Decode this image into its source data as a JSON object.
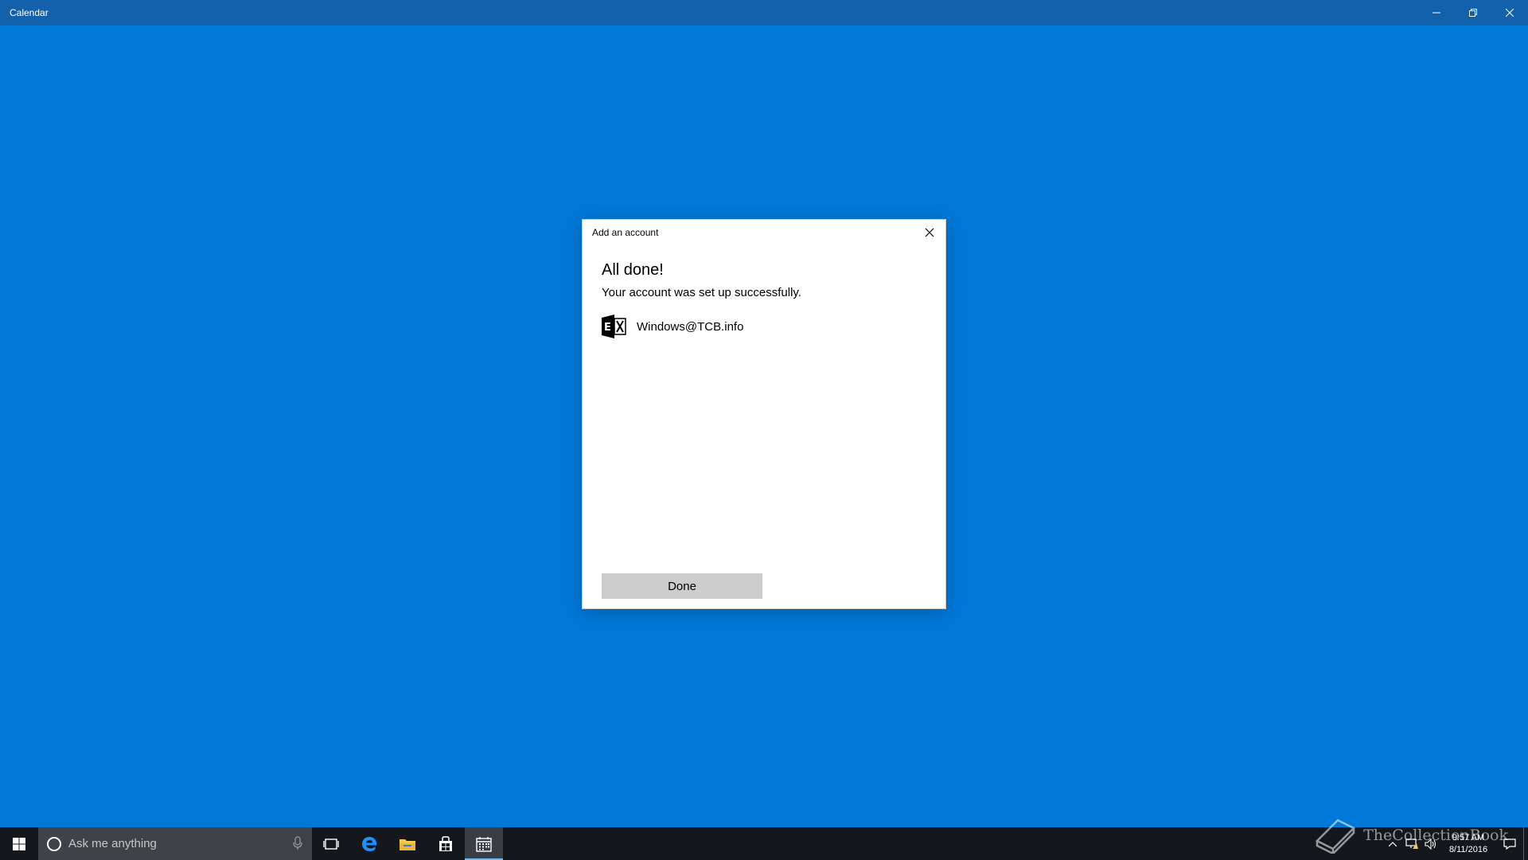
{
  "window": {
    "title": "Calendar",
    "controls": {
      "minimize": "minimize-icon",
      "restore": "restore-icon",
      "close": "close-icon"
    }
  },
  "dialog": {
    "title": "Add an account",
    "heading": "All done!",
    "message": "Your account was set up successfully.",
    "account": {
      "icon": "exchange-icon",
      "email": "Windows@TCB.info"
    },
    "done_label": "Done"
  },
  "taskbar": {
    "search_placeholder": "Ask me anything",
    "pinned": [
      "task-view-icon",
      "edge-icon",
      "file-explorer-icon",
      "store-icon",
      "calendar-icon"
    ],
    "active_app": "calendar",
    "clock": {
      "time": "9:57 AM",
      "date": "8/11/2016"
    }
  },
  "watermark": {
    "text": "TheCollectionBook"
  },
  "colors": {
    "desktop": "#0078d7",
    "titlebar": "#1461ab",
    "taskbar": "#14181d",
    "accent": "#76b9ed"
  }
}
